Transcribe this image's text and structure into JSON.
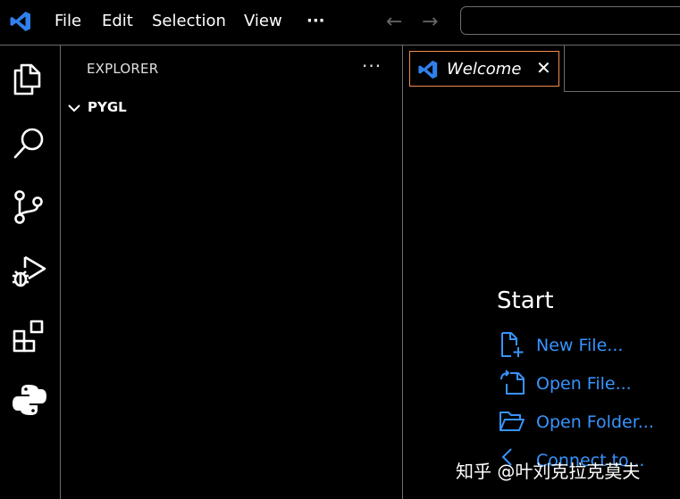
{
  "menu": {
    "file": "File",
    "edit": "Edit",
    "selection": "Selection",
    "view": "View",
    "more": "···"
  },
  "nav": {
    "back": "←",
    "forward": "→"
  },
  "explorer": {
    "title": "EXPLORER",
    "more": "···",
    "folder": "PYGL"
  },
  "tab": {
    "label": "Welcome",
    "close": "✕"
  },
  "welcome": {
    "start_heading": "Start",
    "links": [
      {
        "label": "New File...",
        "icon": "new-file-icon"
      },
      {
        "label": "Open File...",
        "icon": "open-file-icon"
      },
      {
        "label": "Open Folder...",
        "icon": "open-folder-icon"
      },
      {
        "label": "Connect to...",
        "icon": "remote-connect-icon"
      }
    ]
  },
  "watermark": "知乎 @叶刘克拉克莫夫",
  "colors": {
    "background": "#000000",
    "border": "#6b6b6b",
    "link": "#3794ff",
    "tab_focus_border": "#f38a4a",
    "vscode_blue": "#2f80ed",
    "python_blue": "#3776ab",
    "python_yellow": "#ffd43b"
  }
}
